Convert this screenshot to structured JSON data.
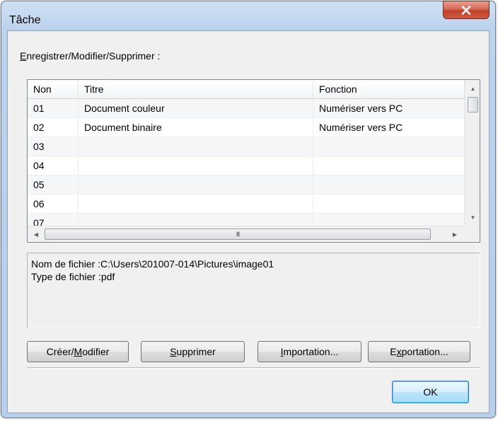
{
  "window": {
    "title": "Tâche",
    "close_icon": "close-icon"
  },
  "group": {
    "label_accel": "E",
    "label_rest": "nregistrer/Modifier/Supprimer :"
  },
  "list": {
    "columns": [
      "Non",
      "Titre",
      "Fonction"
    ],
    "rows": [
      {
        "non": "01",
        "titre": "Document couleur",
        "fonction": "Numériser vers PC"
      },
      {
        "non": "02",
        "titre": "Document binaire",
        "fonction": "Numériser vers PC"
      },
      {
        "non": "03",
        "titre": "",
        "fonction": ""
      },
      {
        "non": "04",
        "titre": "",
        "fonction": ""
      },
      {
        "non": "05",
        "titre": "",
        "fonction": ""
      },
      {
        "non": "06",
        "titre": "",
        "fonction": ""
      },
      {
        "non": "07",
        "titre": "",
        "fonction": ""
      }
    ],
    "scroll_grip": "III"
  },
  "info": {
    "file_name": "Nom de fichier :C:\\Users\\201007-014\\Pictures\\image01",
    "file_type": "Type de fichier :pdf"
  },
  "buttons": {
    "create_pre": "Créer/",
    "create_accel": "M",
    "create_post": "odifier",
    "delete_accel": "S",
    "delete_post": "upprimer",
    "import_accel": "I",
    "import_post": "mportation...",
    "export_pre": "E",
    "export_accel": "x",
    "export_post": "portation...",
    "ok": "OK"
  },
  "colors": {
    "titlebar": "#bcd3ec",
    "close_button": "#c2402a",
    "ok_border": "#3c7fb1"
  }
}
